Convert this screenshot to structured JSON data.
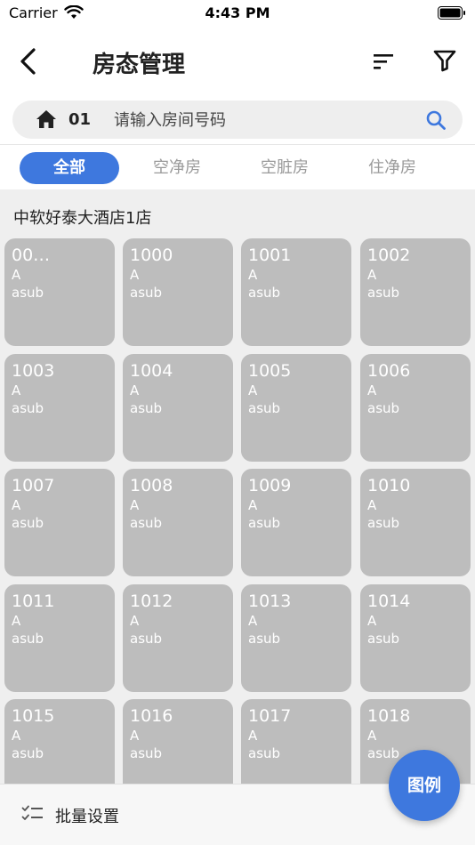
{
  "status": {
    "carrier": "Carrier",
    "time": "4:43 PM"
  },
  "nav": {
    "title": "房态管理",
    "icons": [
      "chevron-left-icon",
      "sort-icon",
      "filter-icon"
    ]
  },
  "search": {
    "prefix": "01",
    "placeholder": "请输入房间号码",
    "value": ""
  },
  "tabs": [
    "全部",
    "空净房",
    "空脏房",
    "住净房"
  ],
  "active_tab": "全部",
  "hotel": {
    "name": "中软好泰大酒店1店"
  },
  "rooms": [
    {
      "number": "00…",
      "type": "A",
      "sub": "asub"
    },
    {
      "number": "1000",
      "type": "A",
      "sub": "asub"
    },
    {
      "number": "1001",
      "type": "A",
      "sub": "asub"
    },
    {
      "number": "1002",
      "type": "A",
      "sub": "asub"
    },
    {
      "number": "1003",
      "type": "A",
      "sub": "asub"
    },
    {
      "number": "1004",
      "type": "A",
      "sub": "asub"
    },
    {
      "number": "1005",
      "type": "A",
      "sub": "asub"
    },
    {
      "number": "1006",
      "type": "A",
      "sub": "asub"
    },
    {
      "number": "1007",
      "type": "A",
      "sub": "asub"
    },
    {
      "number": "1008",
      "type": "A",
      "sub": "asub"
    },
    {
      "number": "1009",
      "type": "A",
      "sub": "asub"
    },
    {
      "number": "1010",
      "type": "A",
      "sub": "asub"
    },
    {
      "number": "1011",
      "type": "A",
      "sub": "asub"
    },
    {
      "number": "1012",
      "type": "A",
      "sub": "asub"
    },
    {
      "number": "1013",
      "type": "A",
      "sub": "asub"
    },
    {
      "number": "1014",
      "type": "A",
      "sub": "asub"
    },
    {
      "number": "1015",
      "type": "A",
      "sub": "asub"
    },
    {
      "number": "1016",
      "type": "A",
      "sub": "asub"
    },
    {
      "number": "1017",
      "type": "A",
      "sub": "asub"
    },
    {
      "number": "1018",
      "type": "A",
      "sub": "asub"
    }
  ],
  "bottom": {
    "batch_label": "批量设置"
  },
  "legend_button": "图例",
  "colors": {
    "accent": "#3e78de",
    "room_tile": "#bdbdbd",
    "content_bg": "#efefef"
  }
}
